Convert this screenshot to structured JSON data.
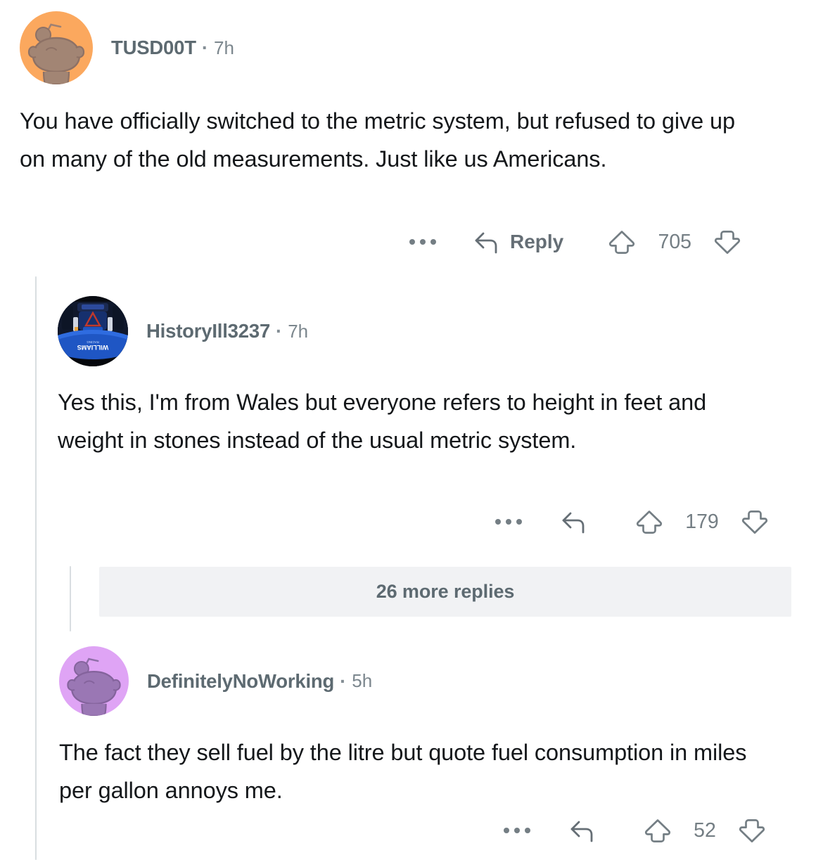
{
  "app": "reddit-comment-thread",
  "colors": {
    "background": "#ffffff",
    "text": "#14171a",
    "muted": "#747e84",
    "username": "#5d6a71",
    "thread_line": "#d9dee1",
    "more_replies_bg": "#f1f2f4",
    "avatar_orange_bg": "#fba85e",
    "avatar_orange_body": "#9f8172",
    "avatar_purple_bg": "#dfa4f5",
    "avatar_purple_body": "#8f6fa8",
    "avatar_f1_dark": "#0a0d16",
    "avatar_f1_blue": "#1f56c4"
  },
  "comments": [
    {
      "id": "comment-1",
      "username": "TUSD00T",
      "separator": "·",
      "timestamp": "7h",
      "avatar_icon": "snoo-avatar-orange",
      "body": "You have officially switched to the metric system, but refused to give up on many of the old measurements. Just like us Americans.",
      "actions": {
        "overflow_icon": "more-options-icon",
        "reply_icon": "reply-arrow-icon",
        "reply_label": "Reply",
        "upvote_icon": "upvote-arrow-icon",
        "score": "705",
        "downvote_icon": "downvote-arrow-icon"
      }
    },
    {
      "id": "comment-2",
      "username": "HistoryIll3237",
      "separator": "·",
      "timestamp": "7h",
      "avatar_icon": "f1-car-avatar",
      "body": "Yes this, I'm from Wales but everyone refers to height in feet and weight in stones instead of the usual metric system.",
      "actions": {
        "overflow_icon": "more-options-icon",
        "reply_icon": "reply-arrow-icon",
        "reply_label": "",
        "upvote_icon": "upvote-arrow-icon",
        "score": "179",
        "downvote_icon": "downvote-arrow-icon"
      }
    },
    {
      "id": "comment-3",
      "username": "DefinitelyNoWorking",
      "separator": "·",
      "timestamp": "5h",
      "avatar_icon": "snoo-avatar-purple",
      "body": "The fact they sell fuel by the litre but quote fuel consumption in miles per gallon annoys me.",
      "actions": {
        "overflow_icon": "more-options-icon",
        "reply_icon": "reply-arrow-icon",
        "reply_label": "",
        "upvote_icon": "upvote-arrow-icon",
        "score": "52",
        "downvote_icon": "downvote-arrow-icon"
      }
    }
  ],
  "more_replies": {
    "label": "26 more replies"
  }
}
